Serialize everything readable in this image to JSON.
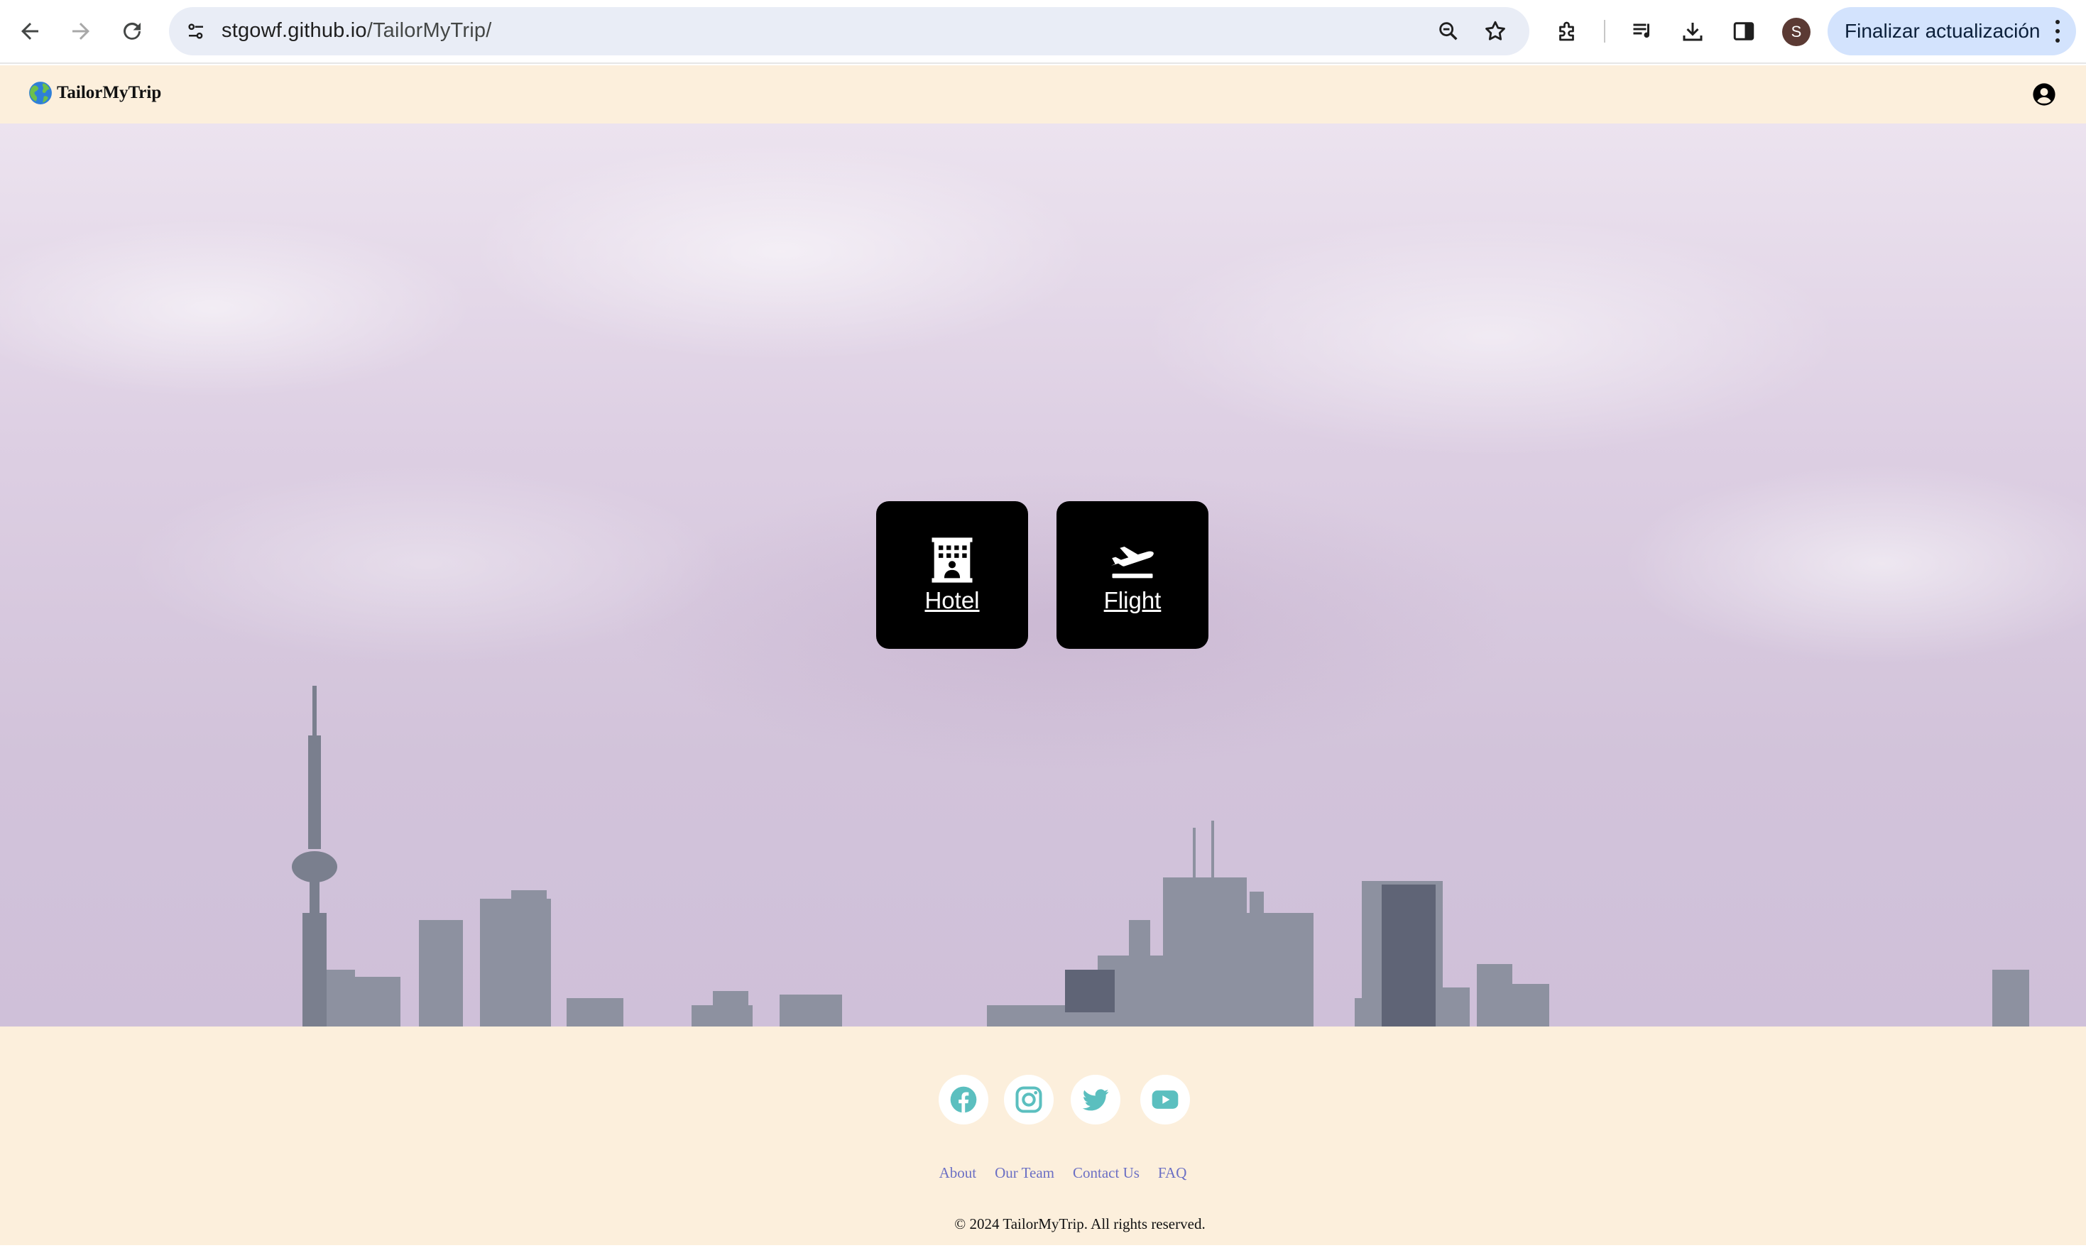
{
  "browser": {
    "url_host": "stgowf.github.io",
    "url_path": "/TailorMyTrip/",
    "profile_initial": "S",
    "update_button_label": "Finalizar actualización"
  },
  "site": {
    "brand_name": "TailorMyTrip"
  },
  "hero": {
    "tiles": [
      {
        "label": "Hotel",
        "icon": "hotel-icon"
      },
      {
        "label": "Flight",
        "icon": "plane-departure-icon"
      }
    ]
  },
  "footer": {
    "social": [
      "facebook-icon",
      "instagram-icon",
      "twitter-icon",
      "youtube-icon"
    ],
    "links": [
      "About",
      "Our Team",
      "Contact Us",
      "FAQ"
    ],
    "copyright": "© 2024 TailorMyTrip. All rights reserved."
  },
  "colors": {
    "header_bg": "#fcefdc",
    "tile_bg": "#000000",
    "social_icon": "#5bbfbf",
    "footer_link": "#6b6fc4",
    "update_button_bg": "#d3e3fd"
  }
}
